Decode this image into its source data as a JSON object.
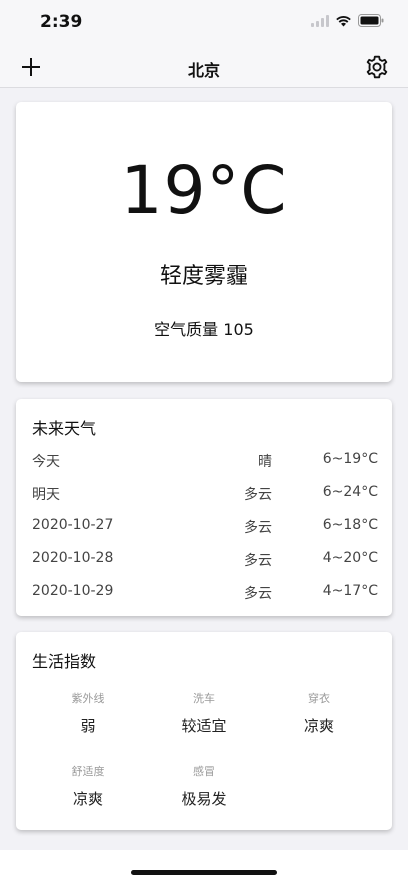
{
  "status_bar": {
    "time": "2:39",
    "icons": [
      "signal-icon",
      "wifi-icon",
      "battery-icon"
    ]
  },
  "nav": {
    "title": "北京",
    "left_icon": "plus-icon",
    "right_icon": "gear-icon"
  },
  "current": {
    "temperature": "19°C",
    "condition": "轻度雾霾",
    "air_quality": "空气质量 105"
  },
  "forecast": {
    "title": "未来天气",
    "days": [
      {
        "date": "今天",
        "condition": "晴",
        "range": "6~19°C"
      },
      {
        "date": "明天",
        "condition": "多云",
        "range": "6~24°C"
      },
      {
        "date": "2020-10-27",
        "condition": "多云",
        "range": "6~18°C"
      },
      {
        "date": "2020-10-28",
        "condition": "多云",
        "range": "4~20°C"
      },
      {
        "date": "2020-10-29",
        "condition": "多云",
        "range": "4~17°C"
      }
    ]
  },
  "life": {
    "title": "生活指数",
    "indices": [
      {
        "label": "紫外线",
        "value": "弱"
      },
      {
        "label": "洗车",
        "value": "较适宜"
      },
      {
        "label": "穿衣",
        "value": "凉爽"
      },
      {
        "label": "舒适度",
        "value": "凉爽"
      },
      {
        "label": "感冒",
        "value": "极易发"
      }
    ]
  },
  "colors": {
    "background": "#f2f2f6",
    "card": "#ffffff",
    "text": "#111111",
    "muted": "#9a9a9a"
  }
}
